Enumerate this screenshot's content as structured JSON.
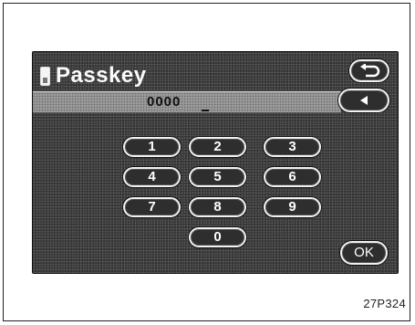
{
  "screen": {
    "title": "Passkey",
    "entry_value": "0000"
  },
  "keypad": [
    {
      "label": "1",
      "name": "key-1"
    },
    {
      "label": "2",
      "name": "key-2"
    },
    {
      "label": "3",
      "name": "key-3"
    },
    {
      "label": "4",
      "name": "key-4"
    },
    {
      "label": "5",
      "name": "key-5"
    },
    {
      "label": "6",
      "name": "key-6"
    },
    {
      "label": "7",
      "name": "key-7"
    },
    {
      "label": "8",
      "name": "key-8"
    },
    {
      "label": "9",
      "name": "key-9"
    },
    {
      "label": "0",
      "name": "key-0"
    }
  ],
  "buttons": {
    "back_icon": "return-arrow-icon",
    "delete_icon": "left-triangle-icon",
    "ok_label": "OK"
  },
  "caption": "27P324"
}
